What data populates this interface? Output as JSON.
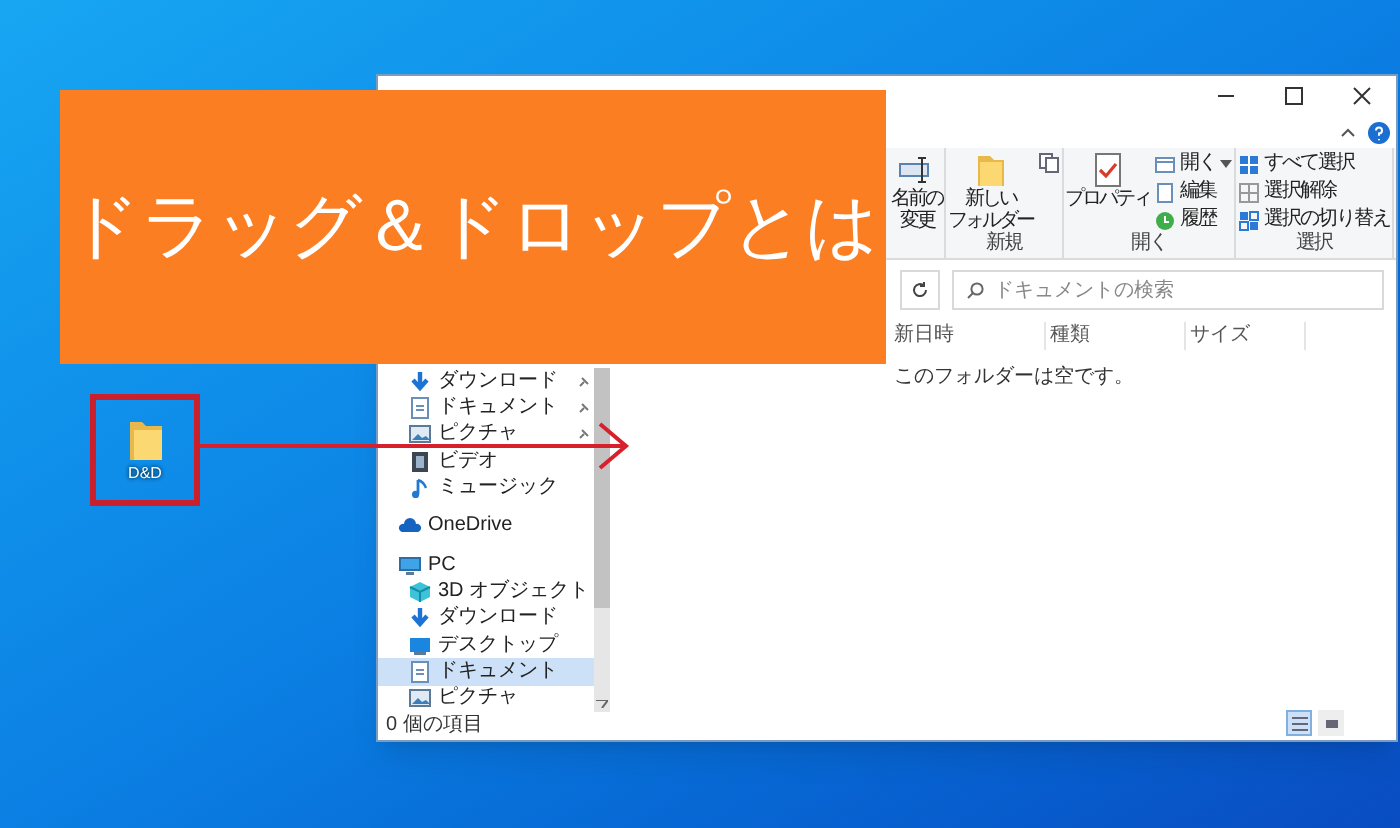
{
  "banner": {
    "title": "ドラッグ＆ドロップとは"
  },
  "desktop_icon": {
    "label": "D&D"
  },
  "explorer": {
    "ribbon_groups": [
      {
        "commands": [
          {
            "kind": "rename",
            "label_lines": [
              "名前の",
              "変更"
            ]
          }
        ]
      },
      {
        "label": "新規",
        "commands": [
          {
            "kind": "new-folder",
            "label_lines": [
              "新しい",
              "フォルダー"
            ]
          },
          {
            "kind": "copy-small"
          }
        ]
      },
      {
        "label": "開く",
        "commands": [
          {
            "kind": "properties",
            "label": "プロパティ"
          },
          {
            "kind": "open",
            "label": "開く",
            "has_menu": true
          },
          {
            "kind": "edit",
            "label": "編集",
            "has_menu": false
          },
          {
            "kind": "history",
            "label": "履歴",
            "has_menu": false
          }
        ]
      },
      {
        "label": "選択",
        "commands": [
          {
            "kind": "select-all",
            "label": "すべて選択"
          },
          {
            "kind": "select-none",
            "label": "選択解除"
          },
          {
            "kind": "invert",
            "label": "選択の切り替え"
          }
        ]
      }
    ],
    "search": {
      "placeholder": "ドキュメントの検索"
    },
    "columns": [
      "新日時",
      "種類",
      "サイズ"
    ],
    "empty_message": "このフォルダーは空です。",
    "sidebar": {
      "quick_access": [
        {
          "label": "ダウンロード",
          "kind": "download",
          "pinned": true,
          "selected": false
        },
        {
          "label": "ドキュメント",
          "kind": "document",
          "pinned": true,
          "selected": false
        },
        {
          "label": "ピクチャ",
          "kind": "picture",
          "pinned": true,
          "selected": false
        },
        {
          "label": "ビデオ",
          "kind": "video",
          "pinned": false,
          "selected": false
        },
        {
          "label": "ミュージック",
          "kind": "music",
          "pinned": false,
          "selected": false
        }
      ],
      "items": [
        {
          "label": "OneDrive",
          "kind": "cloud",
          "selected": false
        },
        {
          "label": "PC",
          "kind": "pc",
          "selected": false,
          "children": [
            {
              "label": "3D オブジェクト",
              "kind": "cube",
              "selected": false
            },
            {
              "label": "ダウンロード",
              "kind": "download",
              "selected": false
            },
            {
              "label": "デスクトップ",
              "kind": "desktop",
              "selected": false
            },
            {
              "label": "ドキュメント",
              "kind": "document",
              "selected": true
            },
            {
              "label": "ピクチャ",
              "kind": "picture",
              "selected": false
            }
          ]
        }
      ]
    },
    "status": "0 個の項目",
    "views": [
      {
        "kind": "details",
        "selected": true
      },
      {
        "kind": "large-icons",
        "selected": false
      }
    ]
  }
}
